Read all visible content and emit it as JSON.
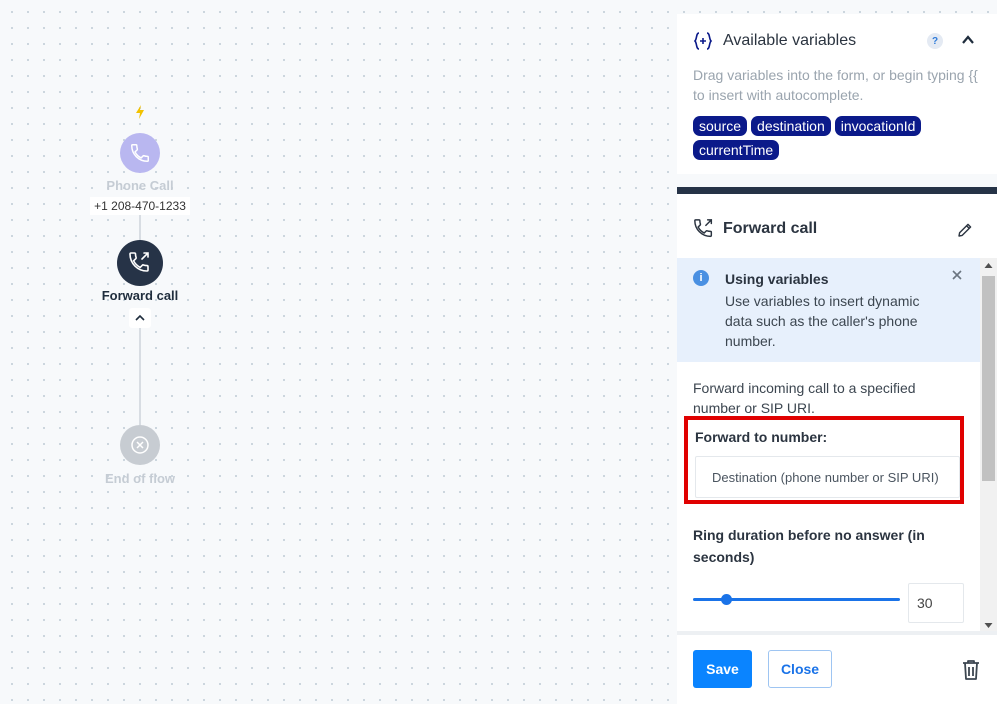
{
  "flow": {
    "start_node": {
      "label": "Phone Call",
      "number": "+1 208-470-1233"
    },
    "forward_node": {
      "label": "Forward call"
    },
    "end_node": {
      "label": "End of flow"
    }
  },
  "variables_panel": {
    "title": "Available variables",
    "help_label": "?",
    "description": "Drag variables into the form, or begin typing {{ to insert with autocomplete.",
    "chips": [
      "source",
      "destination",
      "invocationId",
      "currentTime"
    ]
  },
  "forward_panel": {
    "title": "Forward call",
    "info": {
      "title": "Using variables",
      "text": "Use variables to insert dynamic data such as the caller's phone number.",
      "icon_label": "i"
    },
    "description": "Forward incoming call to a specified number or SIP URI.",
    "forward_field": {
      "label": "Forward to number:",
      "placeholder": "Destination (phone number or SIP URI)"
    },
    "ring": {
      "label": "Ring duration before no answer (in seconds)",
      "value": "30",
      "slider_fraction": 0.16
    },
    "footer": {
      "save_label": "Save",
      "close_label": "Close"
    }
  },
  "colors": {
    "accent": "#0a84ff",
    "dark_node": "#263347",
    "variable_chip": "#0b1a8a",
    "highlight": "#e00000"
  }
}
